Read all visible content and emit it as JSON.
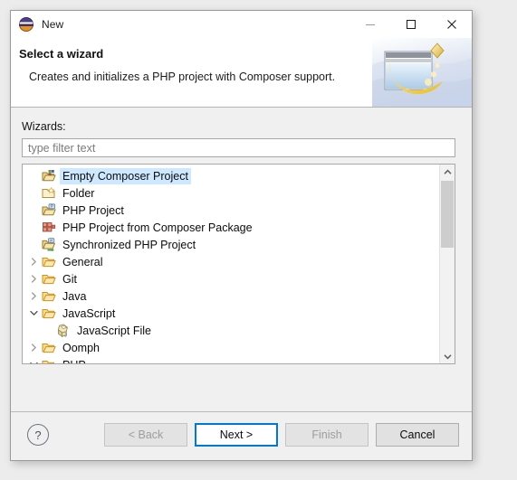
{
  "window": {
    "title": "New",
    "icon": "eclipse-icon",
    "controls": {
      "minimize": "minimize-icon",
      "maximize": "maximize-icon",
      "close": "close-icon"
    }
  },
  "header": {
    "title": "Select a wizard",
    "description": "Creates and initializes a PHP project with Composer support.",
    "banner_icon": "new-wizard-banner-icon"
  },
  "form": {
    "wizards_label": "Wizards:",
    "filter_value": "",
    "filter_placeholder": "type filter text"
  },
  "tree": {
    "selected_index": 0,
    "items": [
      {
        "label": "Empty Composer Project",
        "depth": 1,
        "icon": "composer-project-icon",
        "expander": "none",
        "selected": true
      },
      {
        "label": "Folder",
        "depth": 1,
        "icon": "folder-new-icon",
        "expander": "none",
        "selected": false
      },
      {
        "label": "PHP Project",
        "depth": 1,
        "icon": "php-project-icon",
        "expander": "none",
        "selected": false
      },
      {
        "label": "PHP Project from Composer Package",
        "depth": 1,
        "icon": "composer-package-icon",
        "expander": "none",
        "selected": false
      },
      {
        "label": "Synchronized PHP Project",
        "depth": 1,
        "icon": "sync-php-project-icon",
        "expander": "none",
        "selected": false
      },
      {
        "label": "General",
        "depth": 0,
        "icon": "folder-icon",
        "expander": "collapsed",
        "selected": false
      },
      {
        "label": "Git",
        "depth": 0,
        "icon": "folder-icon",
        "expander": "collapsed",
        "selected": false
      },
      {
        "label": "Java",
        "depth": 0,
        "icon": "folder-icon",
        "expander": "collapsed",
        "selected": false
      },
      {
        "label": "JavaScript",
        "depth": 0,
        "icon": "folder-icon",
        "expander": "expanded",
        "selected": false
      },
      {
        "label": "JavaScript File",
        "depth": 2,
        "icon": "javascript-file-icon",
        "expander": "none",
        "selected": false
      },
      {
        "label": "Oomph",
        "depth": 0,
        "icon": "folder-icon",
        "expander": "collapsed",
        "selected": false
      },
      {
        "label": "PHP",
        "depth": 0,
        "icon": "folder-icon",
        "expander": "expanded",
        "selected": false
      }
    ],
    "scrollbar": {
      "up_icon": "scroll-up-icon",
      "down_icon": "scroll-down-icon"
    }
  },
  "footer": {
    "help_label": "?",
    "buttons": [
      {
        "label": "< Back",
        "name": "back-button",
        "state": "disabled"
      },
      {
        "label": "Next >",
        "name": "next-button",
        "state": "default"
      },
      {
        "label": "Finish",
        "name": "finish-button",
        "state": "disabled"
      },
      {
        "label": "Cancel",
        "name": "cancel-button",
        "state": "normal"
      }
    ]
  },
  "colors": {
    "selection": "#cde8ff",
    "focus": "#0078d7",
    "dialog_bg": "#f0f0f0",
    "backdrop": "#ececed"
  }
}
